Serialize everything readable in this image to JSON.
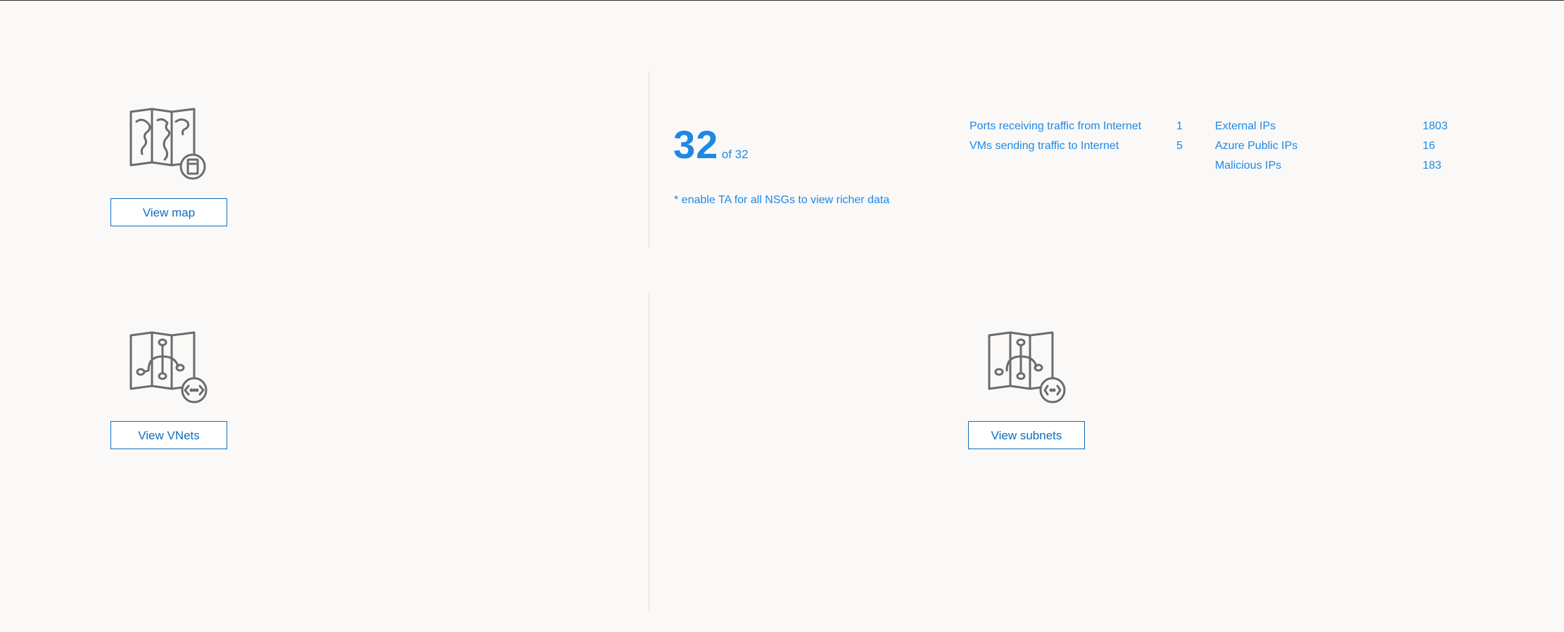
{
  "map_card": {
    "icon": "map-document-icon",
    "button_label": "View map"
  },
  "stats": {
    "count": "32",
    "of_label": "of 32",
    "note": "* enable TA for all NSGs to view richer data",
    "traffic": [
      {
        "label": "Ports receiving traffic from Internet",
        "value": "1"
      },
      {
        "label": "VMs sending traffic to Internet",
        "value": "5"
      }
    ],
    "ips": [
      {
        "label": "External IPs",
        "value": "1803"
      },
      {
        "label": "Azure Public IPs",
        "value": "16"
      },
      {
        "label": "Malicious IPs",
        "value": "183"
      }
    ]
  },
  "vnets_card": {
    "icon": "vnet-map-icon",
    "button_label": "View VNets"
  },
  "subnets_card": {
    "icon": "subnet-map-icon",
    "button_label": "View subnets"
  },
  "colors": {
    "accent": "#1e88e5",
    "button_border": "#0f6cbd",
    "icon_stroke": "#6b6b6b",
    "divider": "#e1dfdd",
    "background": "#faf9f8"
  }
}
